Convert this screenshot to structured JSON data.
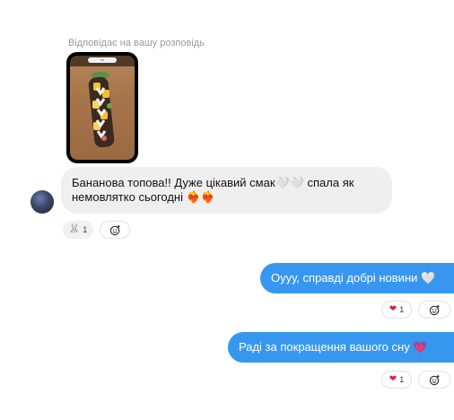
{
  "story_reply": {
    "caption": "Відповідає на вашу розповідь"
  },
  "incoming": {
    "text_line1": "Бананова топова!! Дуже цікавий смак🤍🤍 спала як",
    "text_line2": "немовлятко сьогодні ❤️‍🔥❤️‍🔥",
    "reaction_emoji": "🐰",
    "reaction_count": "1"
  },
  "outgoing": [
    {
      "text": "Оууу, справді добрі новини 🤍",
      "reaction_emoji": "❤",
      "reaction_count": "1"
    },
    {
      "text": "Раді за покращення вашого сну 💗",
      "reaction_emoji": "❤",
      "reaction_count": "1"
    }
  ],
  "icons": {
    "add_reaction": "smiley-plus-icon"
  }
}
